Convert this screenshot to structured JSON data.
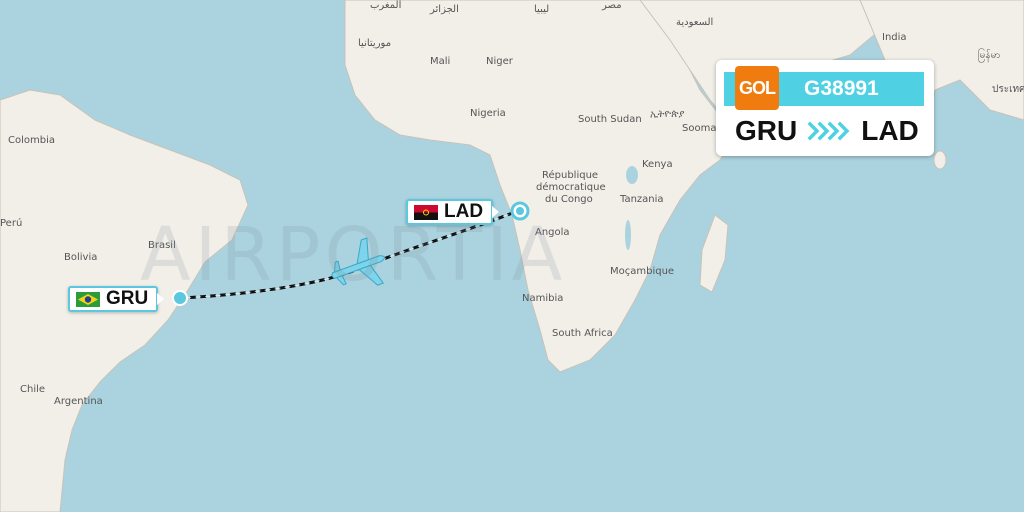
{
  "flight": {
    "airline_logo_text": "GOL",
    "flight_number": "G38991",
    "origin": "GRU",
    "destination": "LAD"
  },
  "watermark": "AIRPORTIA",
  "map_labels": {
    "colombia": "Colombia",
    "peru": "Perú",
    "bolivia": "Bolivia",
    "brasil": "Brasil",
    "chile": "Chile",
    "argentina": "Argentina",
    "morocco": "المغرب",
    "algeria": "الجزائر",
    "libya": "ليبيا",
    "egypt": "مصر",
    "saudi": "السعودية",
    "mauritania": "موريتانيا",
    "mali": "Mali",
    "niger": "Niger",
    "nigeria": "Nigeria",
    "south_sudan": "South Sudan",
    "ethiopia": "ኢትዮጵያ",
    "somalia": "Soomaaliya",
    "drc_1": "République",
    "drc_2": "démocratique",
    "drc_3": "du Congo",
    "kenya": "Kenya",
    "tanzania": "Tanzania",
    "angola": "Angola",
    "mozambique": "Moçambique",
    "namibia": "Namibia",
    "south_africa": "South Africa",
    "india": "India",
    "myanmar": "မြန်မာ",
    "thailand": "ประเทศ"
  },
  "colors": {
    "ocean": "#aad3df",
    "land": "#f2efe9",
    "accent": "#4fd1e3",
    "logo": "#f07c10"
  },
  "icons": {
    "plane": "plane-icon",
    "brazil_flag": "brazil-flag-icon",
    "angola_flag": "angola-flag-icon",
    "arrows": "chevron-arrows-icon"
  }
}
